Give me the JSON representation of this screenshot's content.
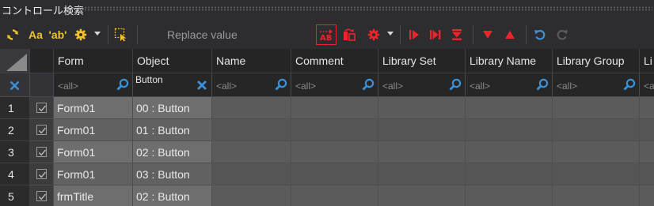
{
  "window": {
    "title": "コントロール検索"
  },
  "toolbar": {
    "font_case_label": "Aa",
    "whole_word_label": "'ab'",
    "replace_label": "Replace value",
    "colors": {
      "yellow": "#f2c12e",
      "red": "#e8262b",
      "blue": "#3d8fd6",
      "gray": "#8a8a8a"
    }
  },
  "columns": [
    {
      "key": "form",
      "label": "Form"
    },
    {
      "key": "object",
      "label": "Object"
    },
    {
      "key": "name",
      "label": "Name"
    },
    {
      "key": "comment",
      "label": "Comment"
    },
    {
      "key": "library_set",
      "label": "Library Set"
    },
    {
      "key": "library_name",
      "label": "Library Name"
    },
    {
      "key": "library_group",
      "label": "Library Group"
    },
    {
      "key": "li_cut",
      "label": "Li"
    }
  ],
  "filters": {
    "form": "<all>",
    "object": "Button",
    "name": "<all>",
    "comment": "<all>",
    "library_set": "<all>",
    "library_name": "<all>",
    "library_group": "<all>",
    "li_cut": "<a"
  },
  "rows": [
    {
      "num": "1",
      "checked": true,
      "form": "Form01",
      "object": "00 : Button"
    },
    {
      "num": "2",
      "checked": true,
      "form": "Form01",
      "object": "01 : Button"
    },
    {
      "num": "3",
      "checked": true,
      "form": "Form01",
      "object": "02 : Button"
    },
    {
      "num": "4",
      "checked": true,
      "form": "Form01",
      "object": "03 : Button"
    },
    {
      "num": "5",
      "checked": true,
      "form": "frmTitle",
      "object": "02 : Button"
    }
  ]
}
